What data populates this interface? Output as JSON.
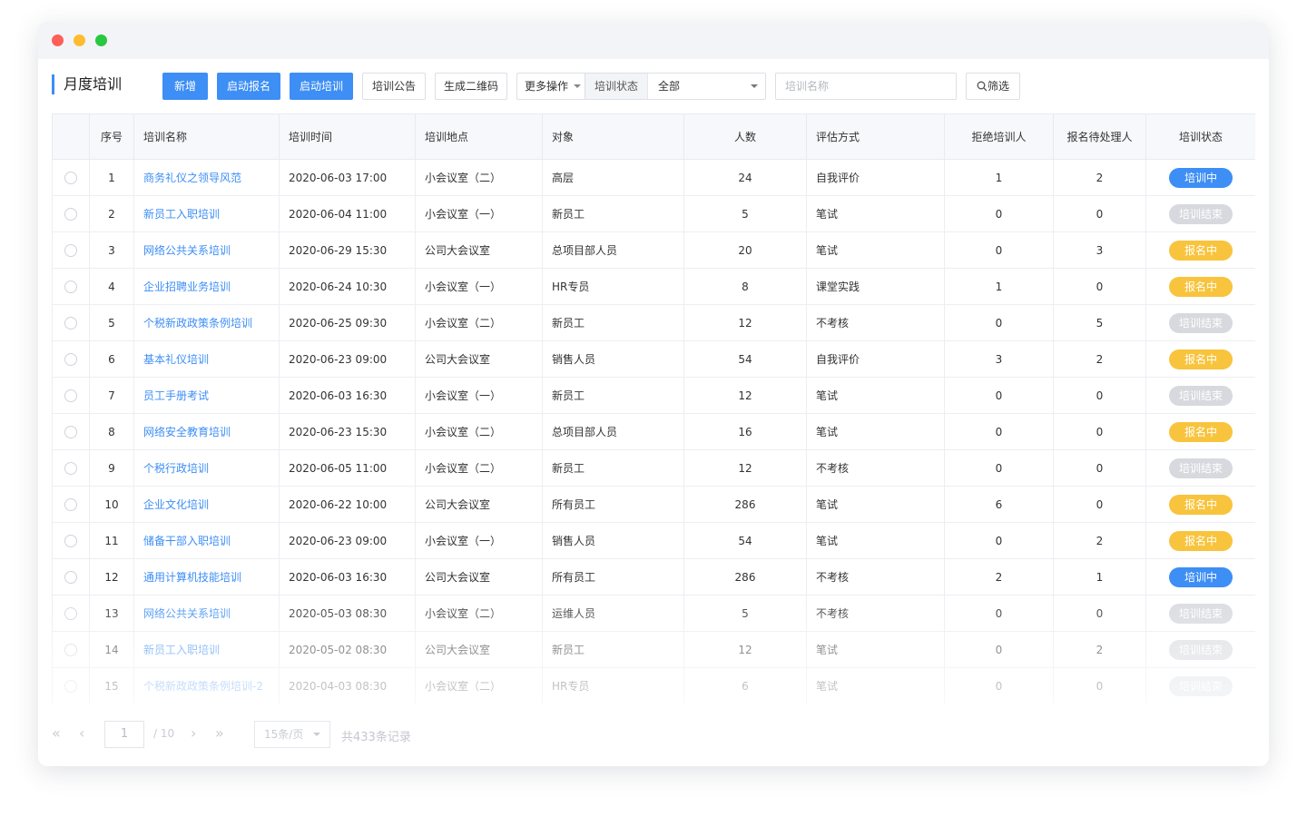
{
  "header": {
    "title": "月度培训"
  },
  "toolbar": {
    "add": "新增",
    "start_registration": "启动报名",
    "start_training": "启动培训",
    "announcement": "培训公告",
    "qr_code": "生成二维码",
    "more": "更多操作",
    "status_label": "培训状态",
    "status_value": "全部",
    "name_placeholder": "培训名称",
    "filter": "筛选"
  },
  "table": {
    "headers": {
      "index": "序号",
      "name": "培训名称",
      "time": "培训时间",
      "location": "培训地点",
      "audience": "对象",
      "count": "人数",
      "evaluation": "评估方式",
      "rejected": "拒绝培训人",
      "pending": "报名待处理人",
      "status": "培训状态"
    },
    "rows": [
      {
        "index": "1",
        "name": "商务礼仪之领导风范",
        "time": "2020-06-03  17:00",
        "location": "小会议室（二）",
        "audience": "高层",
        "count": "24",
        "evaluation": "自我评价",
        "rejected": "1",
        "pending": "2",
        "status": "培训中",
        "status_type": "training"
      },
      {
        "index": "2",
        "name": "新员工入职培训",
        "time": "2020-06-04  11:00",
        "location": "小会议室（一）",
        "audience": "新员工",
        "count": "5",
        "evaluation": "笔试",
        "rejected": "0",
        "pending": "0",
        "status": "培训结束",
        "status_type": "ended"
      },
      {
        "index": "3",
        "name": "网络公共关系培训",
        "time": "2020-06-29  15:30",
        "location": "公司大会议室",
        "audience": "总项目部人员",
        "count": "20",
        "evaluation": "笔试",
        "rejected": "0",
        "pending": "3",
        "status": "报名中",
        "status_type": "registering"
      },
      {
        "index": "4",
        "name": "企业招聘业务培训",
        "time": "2020-06-24  10:30",
        "location": "小会议室（一）",
        "audience": "HR专员",
        "count": "8",
        "evaluation": "课堂实践",
        "rejected": "1",
        "pending": "0",
        "status": "报名中",
        "status_type": "registering"
      },
      {
        "index": "5",
        "name": "个税新政政策条例培训",
        "time": "2020-06-25  09:30",
        "location": "小会议室（二）",
        "audience": "新员工",
        "count": "12",
        "evaluation": "不考核",
        "rejected": "0",
        "pending": "5",
        "status": "培训结束",
        "status_type": "ended"
      },
      {
        "index": "6",
        "name": "基本礼仪培训",
        "time": "2020-06-23  09:00",
        "location": "公司大会议室",
        "audience": "销售人员",
        "count": "54",
        "evaluation": "自我评价",
        "rejected": "3",
        "pending": "2",
        "status": "报名中",
        "status_type": "registering"
      },
      {
        "index": "7",
        "name": "员工手册考试",
        "time": "2020-06-03  16:30",
        "location": "小会议室（一）",
        "audience": "新员工",
        "count": "12",
        "evaluation": "笔试",
        "rejected": "0",
        "pending": "0",
        "status": "培训结束",
        "status_type": "ended"
      },
      {
        "index": "8",
        "name": "网络安全教育培训",
        "time": "2020-06-23  15:30",
        "location": "小会议室（二）",
        "audience": "总项目部人员",
        "count": "16",
        "evaluation": "笔试",
        "rejected": "0",
        "pending": "0",
        "status": "报名中",
        "status_type": "registering"
      },
      {
        "index": "9",
        "name": "个税行政培训",
        "time": "2020-06-05  11:00",
        "location": "小会议室（二）",
        "audience": "新员工",
        "count": "12",
        "evaluation": "不考核",
        "rejected": "0",
        "pending": "0",
        "status": "培训结束",
        "status_type": "ended"
      },
      {
        "index": "10",
        "name": "企业文化培训",
        "time": "2020-06-22  10:00",
        "location": "公司大会议室",
        "audience": "所有员工",
        "count": "286",
        "evaluation": "笔试",
        "rejected": "6",
        "pending": "0",
        "status": "报名中",
        "status_type": "registering"
      },
      {
        "index": "11",
        "name": "储备干部入职培训",
        "time": "2020-06-23  09:00",
        "location": "小会议室（一）",
        "audience": "销售人员",
        "count": "54",
        "evaluation": "笔试",
        "rejected": "0",
        "pending": "2",
        "status": "报名中",
        "status_type": "registering"
      },
      {
        "index": "12",
        "name": "通用计算机技能培训",
        "time": "2020-06-03  16:30",
        "location": "公司大会议室",
        "audience": "所有员工",
        "count": "286",
        "evaluation": "不考核",
        "rejected": "2",
        "pending": "1",
        "status": "培训中",
        "status_type": "training"
      },
      {
        "index": "13",
        "name": "网络公共关系培训",
        "time": "2020-05-03  08:30",
        "location": "小会议室（二）",
        "audience": "运维人员",
        "count": "5",
        "evaluation": "不考核",
        "rejected": "0",
        "pending": "0",
        "status": "培训结束",
        "status_type": "ended"
      },
      {
        "index": "14",
        "name": "新员工入职培训",
        "time": "2020-05-02  08:30",
        "location": "公司大会议室",
        "audience": "新员工",
        "count": "12",
        "evaluation": "笔试",
        "rejected": "0",
        "pending": "2",
        "status": "培训结束",
        "status_type": "ended"
      },
      {
        "index": "15",
        "name": "个税新政政策条例培训-2",
        "time": "2020-04-03  08:30",
        "location": "小会议室（二）",
        "audience": "HR专员",
        "count": "6",
        "evaluation": "笔试",
        "rejected": "0",
        "pending": "0",
        "status": "培训结束",
        "status_type": "ended"
      }
    ]
  },
  "pagination": {
    "current_page": "1",
    "total_pages": "/ 10",
    "page_size": "15条/页",
    "total_records": "共433条记录"
  },
  "colors": {
    "accent": "#3d8ef5",
    "status_training": "#3d8ef5",
    "status_ended": "#d7d9de",
    "status_registering": "#f8c43d"
  },
  "icons": {
    "search": "search-icon",
    "first_page": "double-chevron-left-icon",
    "prev_page": "chevron-left-icon",
    "next_page": "chevron-right-icon",
    "last_page": "double-chevron-right-icon"
  }
}
